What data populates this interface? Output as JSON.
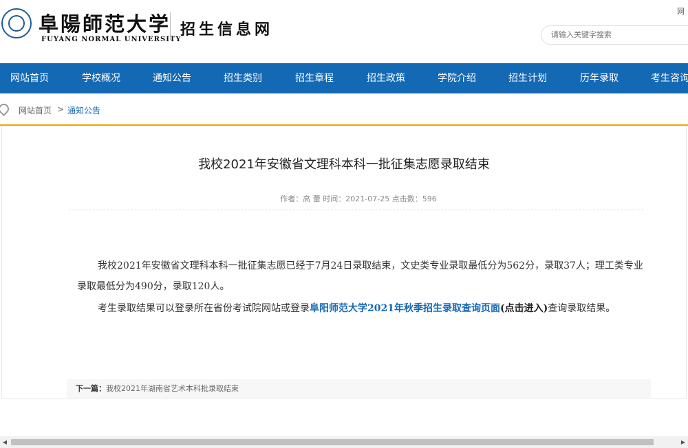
{
  "header": {
    "logo_cn": "阜陽師范大学",
    "logo_en": "FUYANG NORMAL UNIVERSITY",
    "site_title": "招生信息网",
    "top_link": "网",
    "search_placeholder": "请输入关键字搜索"
  },
  "nav": {
    "items": [
      {
        "label": "网站首页"
      },
      {
        "label": "学校概况"
      },
      {
        "label": "通知公告"
      },
      {
        "label": "招生类别"
      },
      {
        "label": "招生章程"
      },
      {
        "label": "招生政策"
      },
      {
        "label": "学院介绍"
      },
      {
        "label": "招生计划"
      },
      {
        "label": "历年录取"
      },
      {
        "label": "考生咨询"
      }
    ]
  },
  "breadcrumb": {
    "home": "网站首页",
    "separator": ">",
    "current": "通知公告"
  },
  "article": {
    "title": "我校2021年安徽省文理科本科一批征集志愿录取结束",
    "meta": "作者：高 蕾 时间：2021-07-25 点击数：596",
    "paragraph1": "我校2021年安徽省文理科本科一批征集志愿已经于7月24日录取结束，文史类专业录取最低分为562分，录取37人；理工类专业录取最低分为490分，录取120人。",
    "paragraph2_prefix": "考生录取结果可以登录所在省份考试院网站或登录",
    "paragraph2_link": "阜阳师范大学2021年秋季招生录取查询页面",
    "paragraph2_click": "(点击进入)",
    "paragraph2_suffix": "查询录取结果。"
  },
  "next_article": {
    "label": "下一篇：",
    "title": "我校2021年湖南省艺术本科批录取结束"
  },
  "colors": {
    "nav_bg": "#1469b5",
    "accent_orange": "#f0a400",
    "link_blue": "#1469b5"
  }
}
